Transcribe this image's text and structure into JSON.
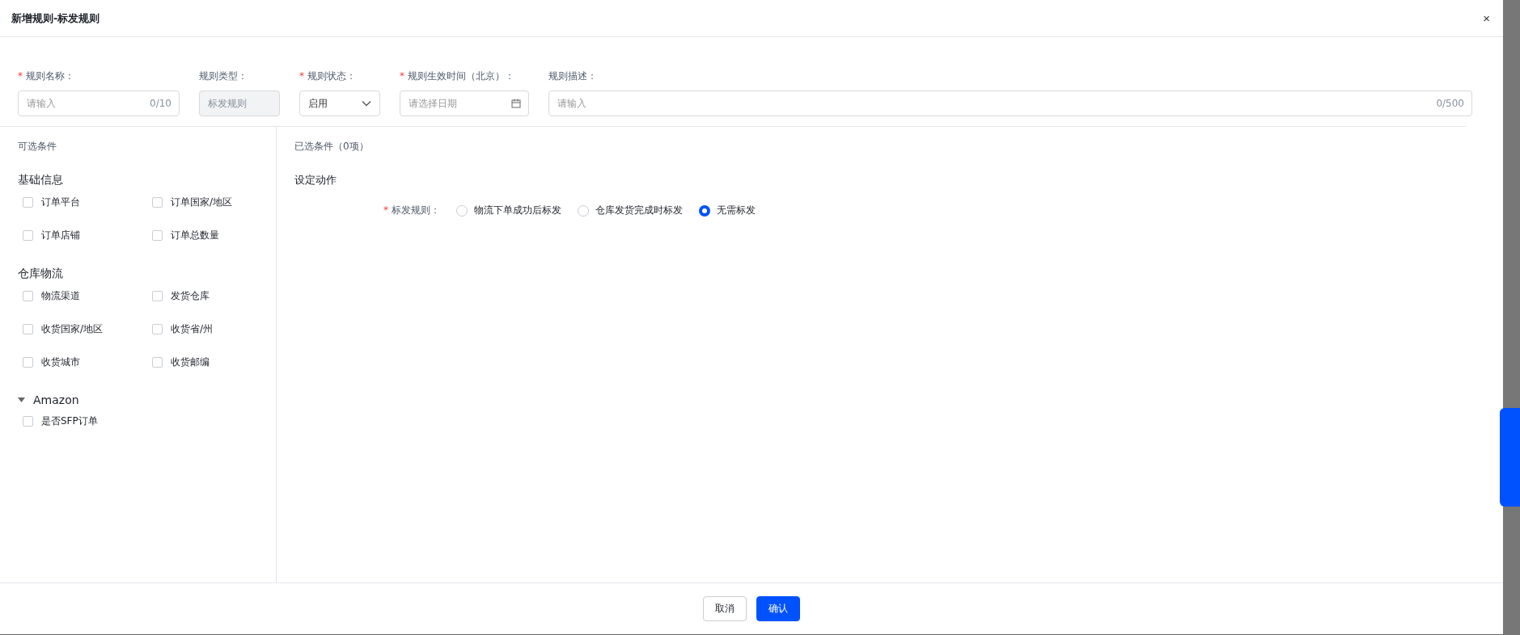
{
  "dialog": {
    "title": "新增规则-标发规则",
    "close": "×"
  },
  "form": {
    "fields": [
      {
        "kind": "text",
        "label": "规则名称：",
        "mark": "*",
        "placeholder": "请输入",
        "counter": "0/10"
      },
      {
        "kind": "readonly",
        "label": "规则类型：",
        "value": "标发规则"
      },
      {
        "kind": "select",
        "label": "规则状态：",
        "mark": "*",
        "value": "启用"
      },
      {
        "kind": "date",
        "label": "规则生效时间（北京）：",
        "mark": "*",
        "placeholder": "请选择日期"
      },
      {
        "kind": "wide",
        "label": "规则描述：",
        "placeholder": "请输入",
        "counter": "0/500"
      }
    ]
  },
  "available": {
    "title": "可选条件",
    "groups": [
      {
        "title": "基础信息",
        "items": [
          {
            "label": "订单平台",
            "checked": false
          },
          {
            "label": "订单国家/地区",
            "checked": false
          },
          {
            "label": "订单店铺",
            "checked": false
          },
          {
            "label": "订单总数量",
            "checked": false
          }
        ]
      },
      {
        "title": "仓库物流",
        "items": [
          {
            "label": "物流渠道",
            "checked": false
          },
          {
            "label": "发货仓库",
            "checked": false
          },
          {
            "label": "收货国家/地区",
            "checked": false
          },
          {
            "label": "收货省/州",
            "checked": false
          },
          {
            "label": "收货城市",
            "checked": false
          },
          {
            "label": "收货邮编",
            "checked": false
          }
        ]
      },
      {
        "title": "Amazon",
        "expanded": true,
        "items": [
          {
            "label": "是否SFP订单",
            "checked": false
          }
        ]
      }
    ]
  },
  "selected_panel": {
    "title": "已选条件（0项）",
    "action_title": "设定动作",
    "rule": {
      "label": "标发规则：",
      "mark": "*",
      "options": [
        {
          "label": "物流下单成功后标发",
          "selected": false
        },
        {
          "label": "仓库发货完成时标发",
          "selected": false
        },
        {
          "label": "无需标发",
          "selected": true
        }
      ]
    }
  },
  "footer": {
    "buttons": [
      {
        "label": "取消",
        "kind": "secondary"
      },
      {
        "label": "确认",
        "kind": "primary"
      }
    ]
  }
}
